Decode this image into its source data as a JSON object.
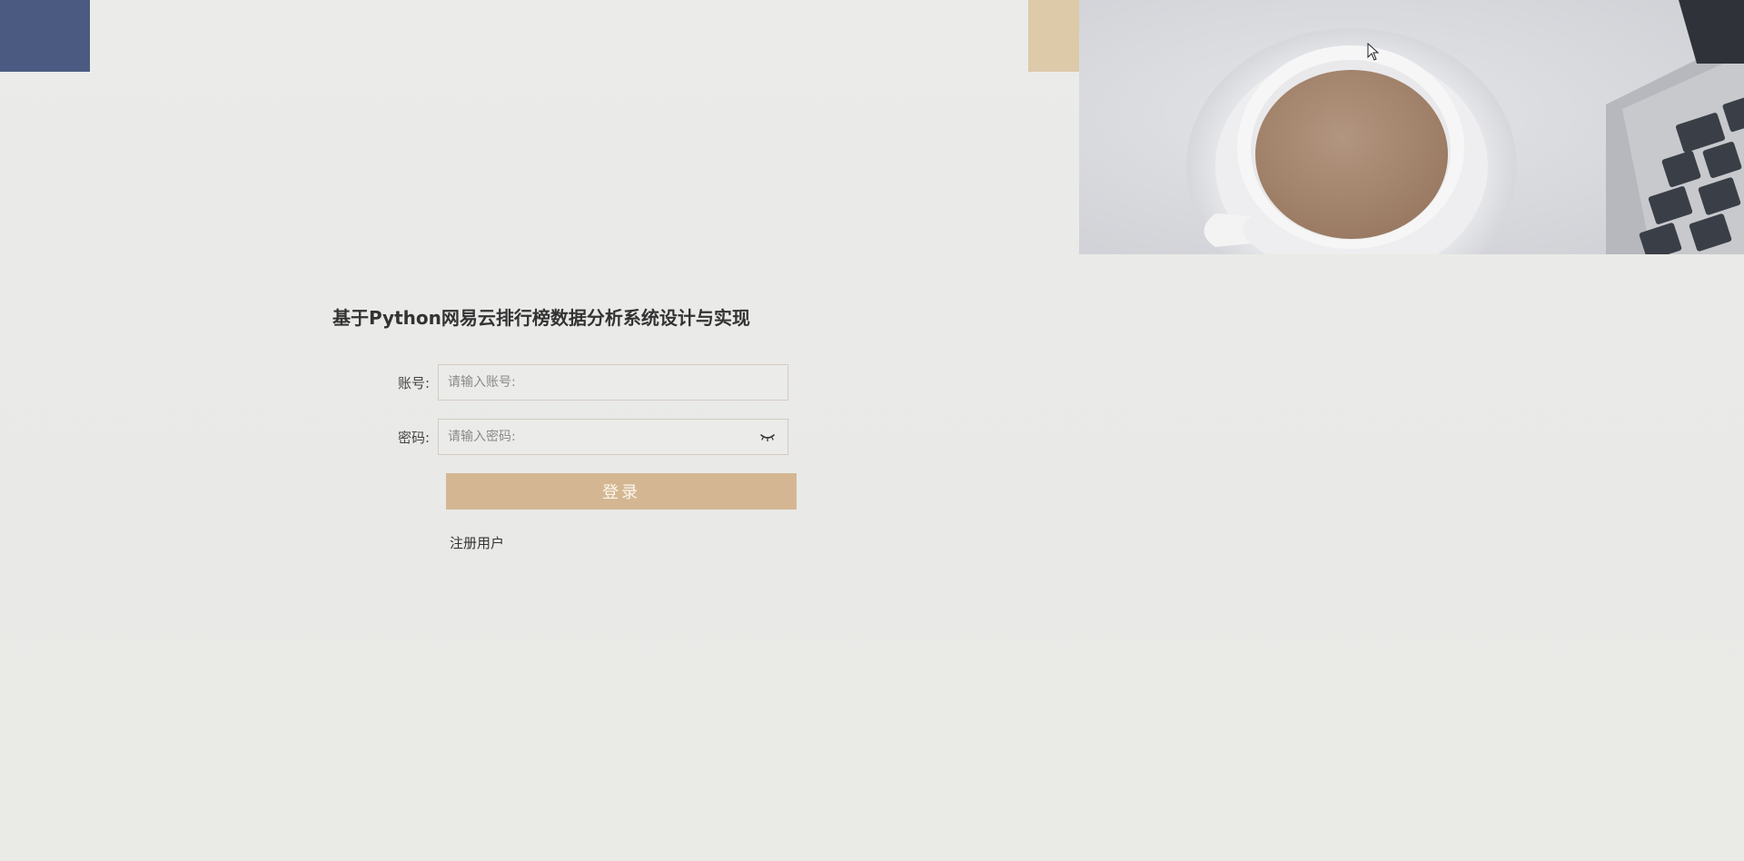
{
  "app": {
    "title": "基于Python网易云排行榜数据分析系统设计与实现"
  },
  "form": {
    "account_label": "账号:",
    "account_placeholder": "请输入账号:",
    "password_label": "密码:",
    "password_placeholder": "请输入密码:",
    "login_label": "登录",
    "register_label": "注册用户"
  },
  "icons": {
    "password_toggle": "eye-closed-icon",
    "cursor": "mouse-pointer-icon"
  },
  "colors": {
    "background": "#eaeae8",
    "accent_navy": "#4b5a80",
    "accent_tan": "#d4b792",
    "title_text": "#333333"
  }
}
